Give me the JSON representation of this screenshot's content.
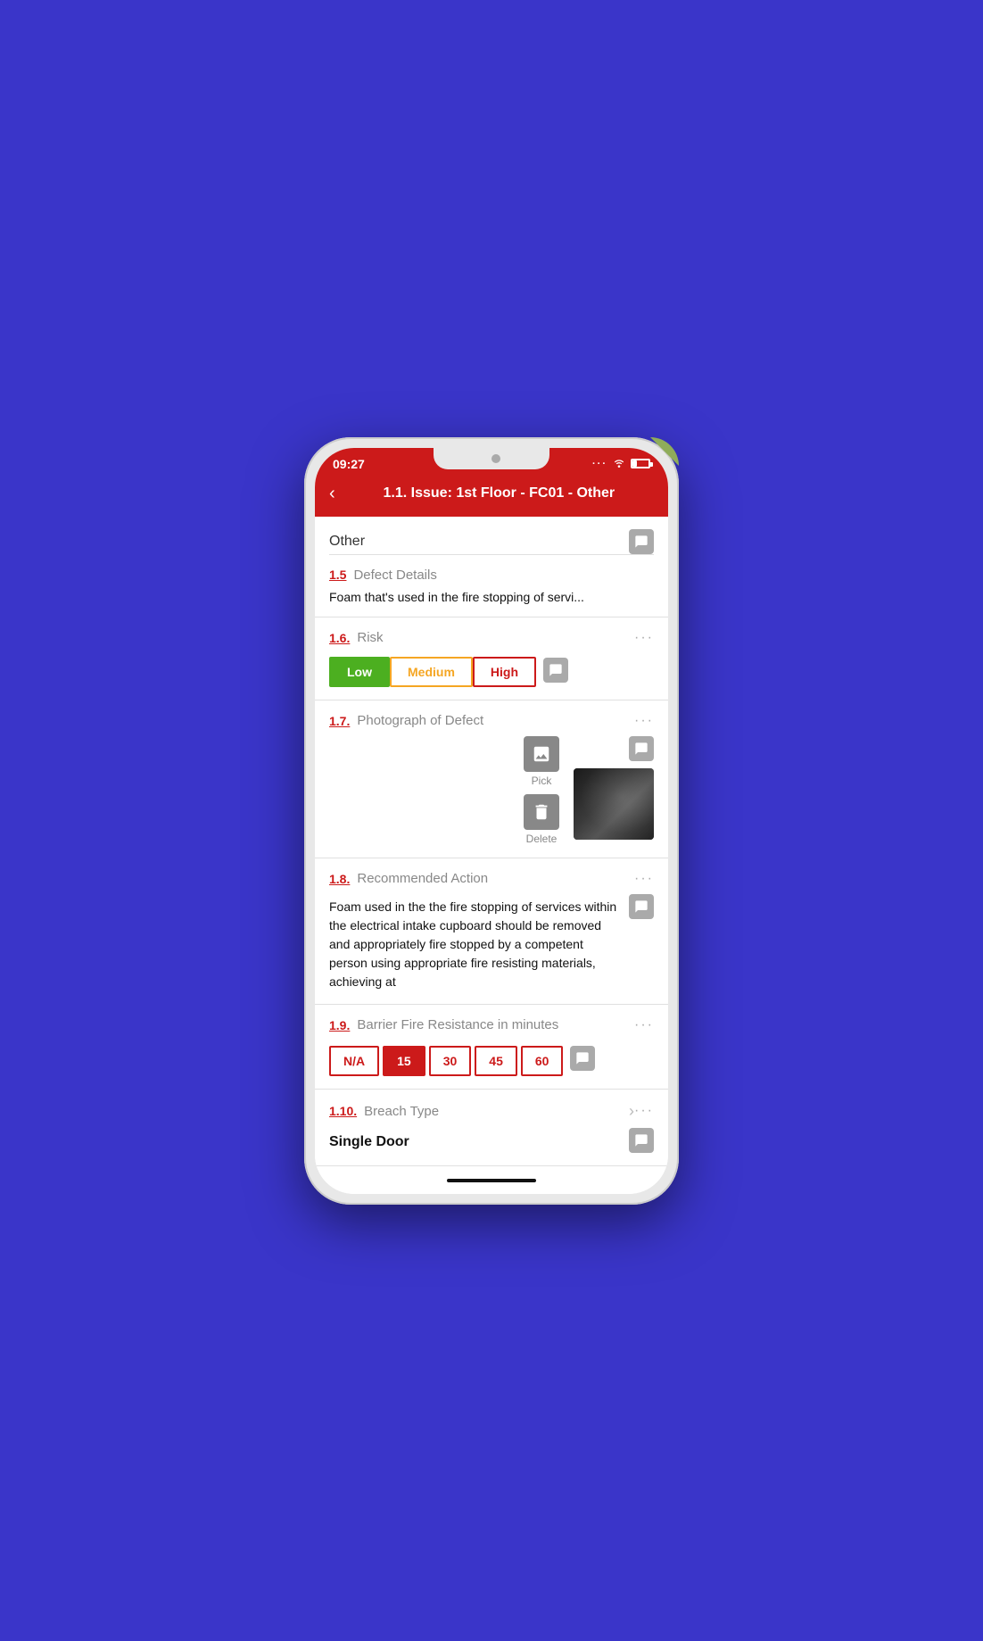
{
  "statusBar": {
    "time": "09:27",
    "wifiLabel": "wifi",
    "batteryLabel": "battery"
  },
  "navBar": {
    "backLabel": "‹",
    "title": "1.1. Issue: 1st Floor - FC01  - Other"
  },
  "topSection": {
    "label": "Other"
  },
  "sections": [
    {
      "id": "1.5",
      "label": "Defect Details",
      "showDots": false,
      "showComment": false,
      "content": "Foam that's used in the fire stopping of servi..."
    },
    {
      "id": "1.6",
      "label": "Risk",
      "showDots": true,
      "showComment": true,
      "riskOptions": [
        "Low",
        "Medium",
        "High"
      ],
      "riskSelected": "Low"
    },
    {
      "id": "1.7",
      "label": "Photograph of Defect",
      "showDots": true,
      "showComment": true,
      "pickLabel": "Pick",
      "deleteLabel": "Delete"
    },
    {
      "id": "1.8",
      "label": "Recommended Action",
      "showDots": true,
      "showComment": true,
      "content": "Foam used in the the fire stopping of services within the electrical intake cupboard should be removed and appropriately fire stopped by a competent person using appropriate fire resisting materials, achieving at"
    },
    {
      "id": "1.9",
      "label": "Barrier Fire Resistance in minutes",
      "showDots": true,
      "showComment": true,
      "barrierOptions": [
        "N/A",
        "15",
        "30",
        "45",
        "60"
      ],
      "barrierSelected": "15"
    },
    {
      "id": "1.10",
      "label": "Breach Type",
      "showDots": true,
      "showComment": true,
      "value": "Single Door",
      "hasChevron": true
    }
  ],
  "colors": {
    "brand": "#cc1a1a",
    "lowRisk": "#4caf20",
    "mediumRisk": "#f5a623",
    "highRisk": "#cc1a1a"
  }
}
